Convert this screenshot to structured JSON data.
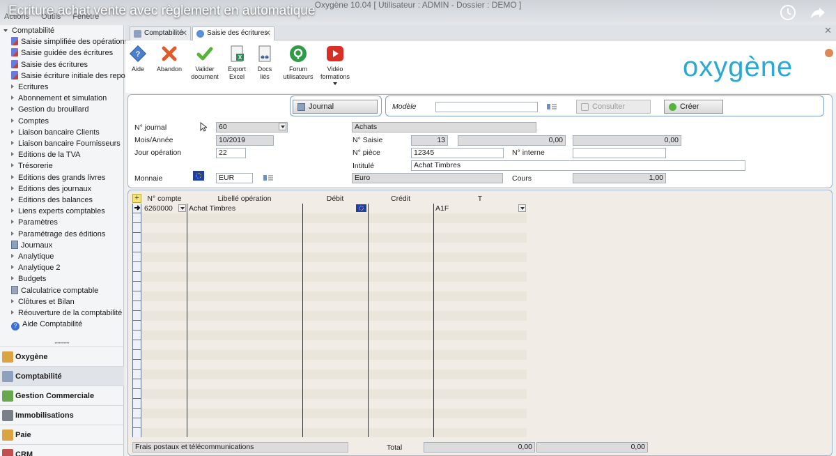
{
  "window": {
    "title": "Oxygène 10.04 [ Utilisateur : ADMIN - Dossier : DEMO ]",
    "menu": [
      "Actions",
      "Outils",
      "Fenêtre"
    ],
    "video_title": "Ecriture achat vente avec règlement en automatique"
  },
  "sidebar": {
    "tree": [
      {
        "label": "Comptabilité",
        "level": 0,
        "icon": "expand-arrow-icon"
      },
      {
        "label": "Saisie simplifiée des opérations",
        "level": 1,
        "icon": "edit-document-icon"
      },
      {
        "label": "Saisie guidée des écritures",
        "level": 1,
        "icon": "edit-document-icon"
      },
      {
        "label": "Saisie des écritures",
        "level": 1,
        "icon": "edit-document-icon"
      },
      {
        "label": "Saisie écriture initiale des reports",
        "level": 1,
        "icon": "edit-document-icon"
      },
      {
        "label": "Ecritures",
        "level": 1,
        "icon": "collapse-arrow-icon"
      },
      {
        "label": "Abonnement et simulation",
        "level": 1,
        "icon": "collapse-arrow-icon"
      },
      {
        "label": "Gestion du brouillard",
        "level": 1,
        "icon": "collapse-arrow-icon"
      },
      {
        "label": "Comptes",
        "level": 1,
        "icon": "collapse-arrow-icon"
      },
      {
        "label": "Liaison bancaire Clients",
        "level": 1,
        "icon": "collapse-arrow-icon"
      },
      {
        "label": "Liaison bancaire Fournisseurs",
        "level": 1,
        "icon": "collapse-arrow-icon"
      },
      {
        "label": "Editions de la TVA",
        "level": 1,
        "icon": "collapse-arrow-icon"
      },
      {
        "label": "Trésorerie",
        "level": 1,
        "icon": "collapse-arrow-icon"
      },
      {
        "label": "Editions des grands livres",
        "level": 1,
        "icon": "collapse-arrow-icon"
      },
      {
        "label": "Editions des journaux",
        "level": 1,
        "icon": "collapse-arrow-icon"
      },
      {
        "label": "Editions des balances",
        "level": 1,
        "icon": "collapse-arrow-icon"
      },
      {
        "label": "Liens experts comptables",
        "level": 1,
        "icon": "collapse-arrow-icon"
      },
      {
        "label": "Paramètres",
        "level": 1,
        "icon": "collapse-arrow-icon"
      },
      {
        "label": "Paramétrage des éditions",
        "level": 1,
        "icon": "collapse-arrow-icon"
      },
      {
        "label": "Journaux",
        "level": 1,
        "icon": "book-icon"
      },
      {
        "label": "Analytique",
        "level": 1,
        "icon": "collapse-arrow-icon"
      },
      {
        "label": "Analytique 2",
        "level": 1,
        "icon": "collapse-arrow-icon"
      },
      {
        "label": "Budgets",
        "level": 1,
        "icon": "collapse-arrow-icon"
      },
      {
        "label": "Calculatrice comptable",
        "level": 1,
        "icon": "calculator-icon"
      },
      {
        "label": "Clôtures et Bilan",
        "level": 1,
        "icon": "collapse-arrow-icon"
      },
      {
        "label": "Réouverture de la comptabilité",
        "level": 1,
        "icon": "collapse-arrow-icon"
      },
      {
        "label": "Aide Comptabilité",
        "level": 1,
        "icon": "help-icon"
      }
    ],
    "modules": [
      {
        "label": "Oxygène",
        "color": "#d9a441"
      },
      {
        "label": "Comptabilité",
        "color": "#8da0bd"
      },
      {
        "label": "Gestion Commerciale",
        "color": "#6aa84f"
      },
      {
        "label": "Immobilisations",
        "color": "#7a8088"
      },
      {
        "label": "Paie",
        "color": "#d9a441"
      },
      {
        "label": "CRM",
        "color": "#c0504d"
      }
    ]
  },
  "tabs": [
    {
      "label": "Comptabilité"
    },
    {
      "label": "Saisie des écritures"
    }
  ],
  "toolbar": {
    "buttons": [
      {
        "l1": "Aide",
        "l2": "",
        "icon": "help-diamond-icon"
      },
      {
        "l1": "Abandon",
        "l2": "",
        "icon": "cancel-x-icon"
      },
      {
        "l1": "Valider",
        "l2": "document",
        "icon": "check-icon"
      },
      {
        "l1": "Export",
        "l2": "Excel",
        "icon": "excel-export-icon"
      },
      {
        "l1": "Docs",
        "l2": "liés",
        "icon": "linked-docs-icon"
      },
      {
        "l1": "Forum",
        "l2": "utilisateurs",
        "icon": "forum-icon"
      },
      {
        "l1": "Vidéo",
        "l2": "formations",
        "icon": "video-play-icon"
      }
    ],
    "logo": "oxygène"
  },
  "header_form": {
    "journal_button": "Journal",
    "modele_label": "Modèle",
    "modele_value": "",
    "consulter_button": "Consulter",
    "creer_button": "Créer",
    "journal_label": "N° journal",
    "journal_value": "60",
    "journal_name": "Achats",
    "mois_label": "Mois/Année",
    "mois_value": "10/2019",
    "jour_label": "Jour opération",
    "jour_value": "22",
    "monnaie_label": "Monnaie",
    "monnaie_value": "EUR",
    "saisie_label": "N° Saisie",
    "saisie_value": "13",
    "total_debit": "0,00",
    "total_credit": "0,00",
    "piece_label": "N° pièce",
    "piece_value": "12345",
    "interne_label": "N° interne",
    "interne_value": "",
    "intitule_label": "Intitulé",
    "intitule_value": "Achat Timbres",
    "devise_name": "Euro",
    "cours_label": "Cours",
    "cours_value": "1,00"
  },
  "grid": {
    "columns": [
      "N° compte",
      "Libellé opération",
      "Débit",
      "Crédit",
      "T"
    ],
    "rows": [
      {
        "compte": "6260000",
        "libelle": "Achat Timbres",
        "debit": "",
        "credit": "",
        "t": "A1F"
      }
    ]
  },
  "footer": {
    "account_label": "Frais postaux et télécommunications",
    "total_label": "Total",
    "total_debit": "0,00",
    "total_credit": "0,00"
  }
}
